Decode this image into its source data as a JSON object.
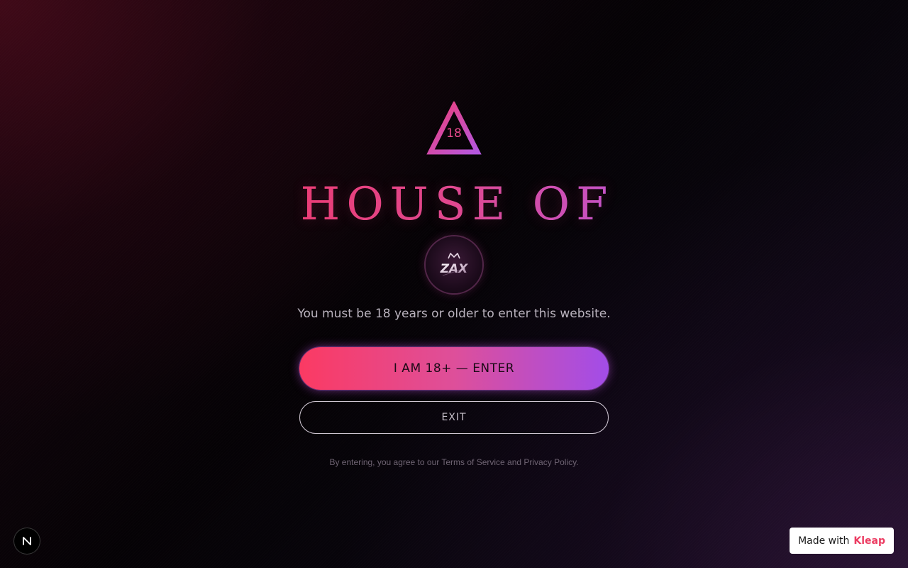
{
  "age_gate": {
    "icon": "age-18-triangle-icon",
    "icon_text": "18",
    "title": "HOUSE OF",
    "logo": "zax-crown-logo",
    "logo_text": "ZAX",
    "message": "You must be 18 years or older to enter this website.",
    "enter_label": "I AM 18+ — ENTER",
    "exit_label": "EXIT",
    "legal_text": "By entering, you agree to our Terms of Service and Privacy Policy."
  },
  "dev_indicator": {
    "icon": "nextjs-icon",
    "letter": "N"
  },
  "made_with": {
    "prefix": "Made with",
    "brand": "Kleap"
  },
  "colors": {
    "accent_pink": "#fb3a63",
    "accent_purple": "#a24de8",
    "brand_pink": "#ec3c62"
  }
}
